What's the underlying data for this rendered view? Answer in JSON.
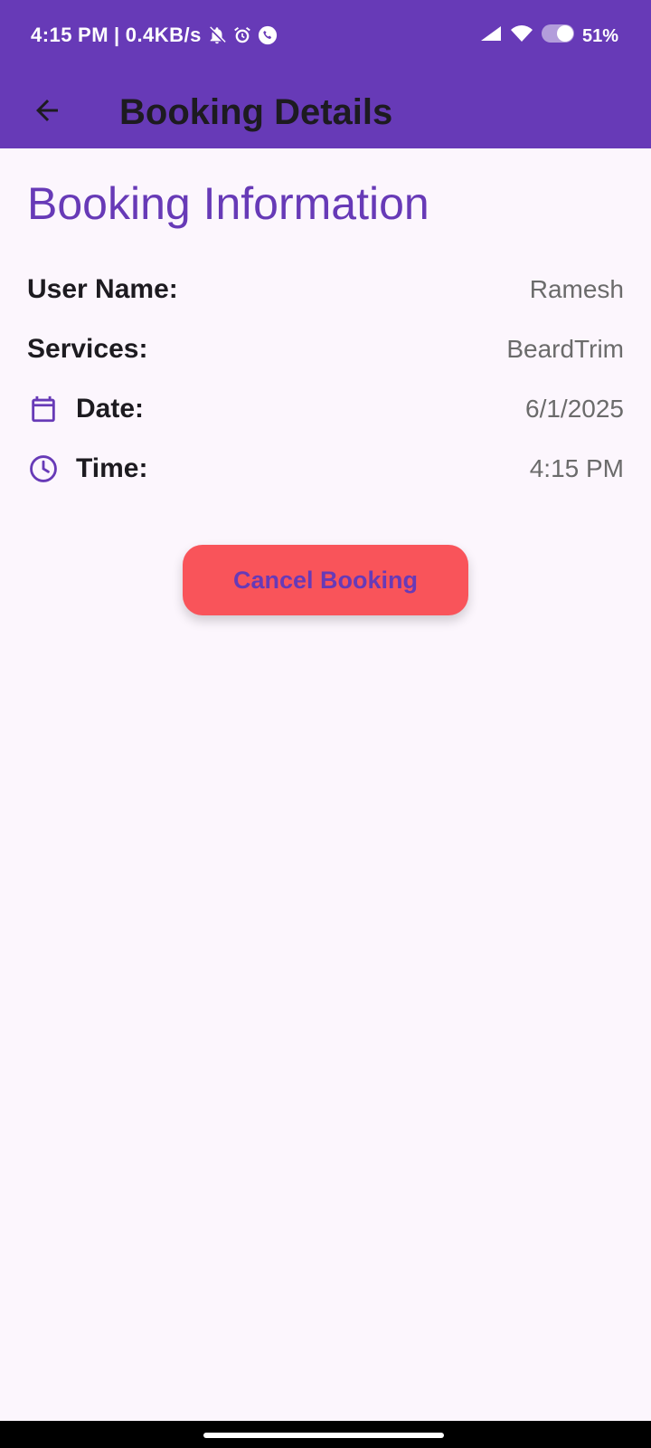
{
  "status_bar": {
    "time": "4:15",
    "ampm": "PM",
    "separator": "|",
    "network_speed": "0.4KB/s",
    "battery": "51%",
    "icons": [
      "bell-off-icon",
      "alarm-icon",
      "call-icon",
      "signal-icon",
      "wifi-icon",
      "toggle-icon"
    ]
  },
  "app_bar": {
    "title": "Booking Details",
    "back_icon": "arrow-back-icon",
    "background": "#673AB7"
  },
  "booking": {
    "section_title": "Booking Information",
    "rows": [
      {
        "label": "User Name:",
        "value": "Ramesh",
        "icon": null
      },
      {
        "label": "Services:",
        "value": "BeardTrim",
        "icon": null
      },
      {
        "label": "Date:",
        "value": "6/1/2025",
        "icon": "calendar-icon"
      },
      {
        "label": "Time:",
        "value": "4:15 PM",
        "icon": "clock-icon"
      }
    ]
  },
  "actions": {
    "cancel_label": "Cancel Booking",
    "cancel_color": "#F9545A"
  },
  "colors": {
    "accent": "#673AB7",
    "page_background": "#FCF6FD"
  }
}
